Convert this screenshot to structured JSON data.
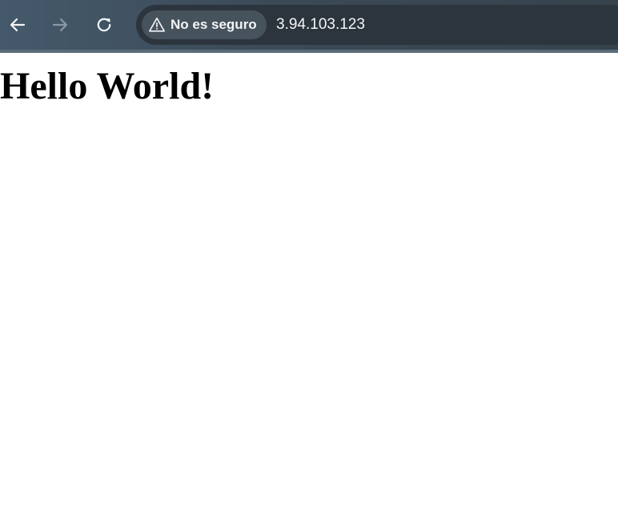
{
  "browser": {
    "security_label": "No es seguro",
    "security_icon": "warning-triangle-icon",
    "url": "3.94.103.123",
    "nav": {
      "back_icon": "back-arrow-icon",
      "forward_icon": "forward-arrow-icon",
      "reload_icon": "reload-icon"
    },
    "colors": {
      "toolbar": "#3b4a57",
      "omnibox": "#2c353d",
      "chip": "#46525c",
      "text": "#f3f5f7"
    }
  },
  "page": {
    "heading": "Hello World!"
  }
}
